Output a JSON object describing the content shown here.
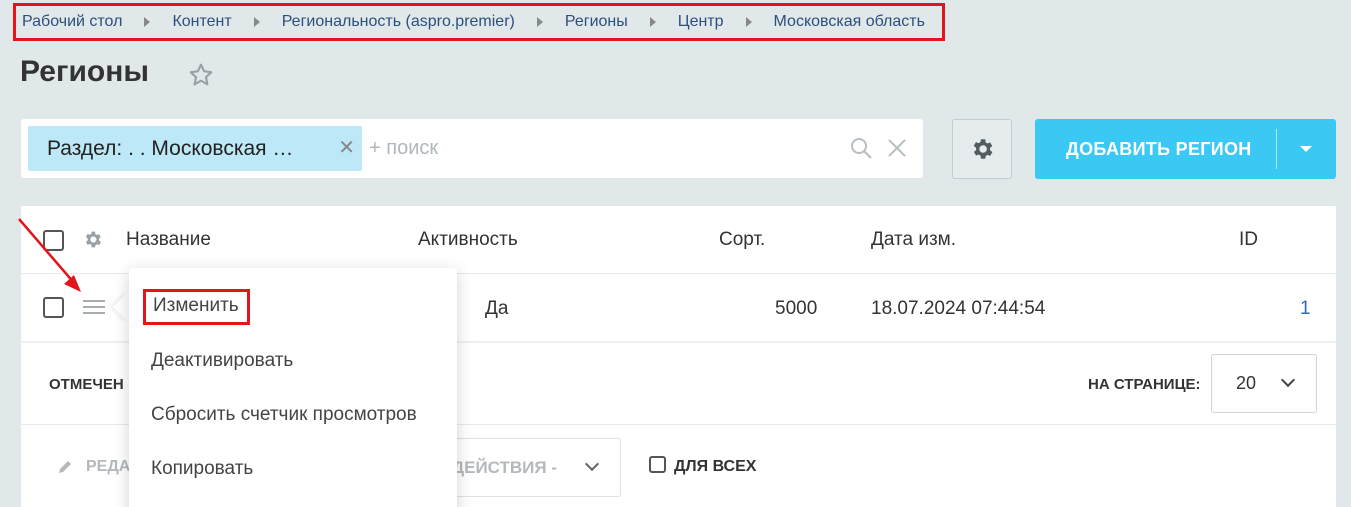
{
  "breadcrumb": [
    "Рабочий стол",
    "Контент",
    "Региональность (aspro.premier)",
    "Регионы",
    "Центр",
    "Московская область"
  ],
  "page_title": "Регионы",
  "filter": {
    "chip_label": "Раздел: . . Московская …",
    "search_placeholder": "+ поиск"
  },
  "add_button": {
    "label": "ДОБАВИТЬ РЕГИОН"
  },
  "grid": {
    "columns": [
      "Название",
      "Активность",
      "Сорт.",
      "Дата изм.",
      "ID"
    ],
    "rows": [
      {
        "name": "",
        "active": "Да",
        "sort": "5000",
        "modified": "18.07.2024 07:44:54",
        "id": "1"
      }
    ]
  },
  "footer": {
    "selected_label": "ОТМЕЧЕН",
    "per_page_label": "НА СТРАНИЦЕ:",
    "per_page_value": "20"
  },
  "actions": {
    "edit_label": "РЕДА",
    "actions_select": "ДЕЙСТВИЯ -",
    "for_all_label": "ДЛЯ ВСЕХ"
  },
  "context_menu": {
    "items": [
      "Изменить",
      "Деактивировать",
      "Сбросить счетчик просмотров",
      "Копировать"
    ]
  },
  "colors": {
    "accent": "#3bc8f5",
    "highlight_border": "#e3141a",
    "background": "#e1e8ea",
    "chip_bg": "#bce8f7"
  }
}
